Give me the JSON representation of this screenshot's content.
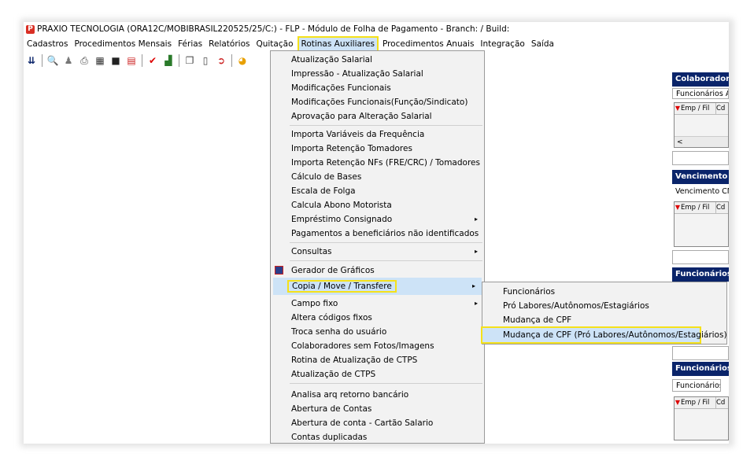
{
  "window": {
    "title": "PRAXIO TECNOLOGIA (ORA12C/MOBIBRASIL220525/25/C:) - FLP - Módulo de Folha de Pagamento - Branch:  / Build:"
  },
  "menubar": [
    {
      "label": "Cadastros"
    },
    {
      "label": "Procedimentos Mensais"
    },
    {
      "label": "Férias"
    },
    {
      "label": "Relatórios"
    },
    {
      "label": "Quitação"
    },
    {
      "label": "Rotinas Auxiliares"
    },
    {
      "label": "Procedimentos Anuais"
    },
    {
      "label": "Integração"
    },
    {
      "label": "Saída"
    }
  ],
  "toolbar_icons": [
    "down-arrows-icon",
    "search-icon",
    "users-icon",
    "printer-icon",
    "calculator-icon",
    "save-icon",
    "report-icon",
    "checkmark-icon",
    "chart-icon",
    "copy-icon",
    "document-icon",
    "export-icon",
    "pie-chart-icon"
  ],
  "menu": {
    "items": [
      {
        "label": "Atualização Salarial"
      },
      {
        "label": "Impressão - Atualização Salarial"
      },
      {
        "label": "Modificações Funcionais"
      },
      {
        "label": "Modificações Funcionais(Função/Sindicato)"
      },
      {
        "label": "Aprovação para Alteração Salarial"
      },
      {
        "label": "Importa Variáveis da Frequência"
      },
      {
        "label": "Importa Retenção Tomadores"
      },
      {
        "label": "Importa Retenção NFs (FRE/CRC) / Tomadores"
      },
      {
        "label": "Cálculo de Bases"
      },
      {
        "label": "Escala de Folga"
      },
      {
        "label": "Calcula Abono Motorista"
      },
      {
        "label": "Empréstimo Consignado"
      },
      {
        "label": "Pagamentos a beneficiários não identificados"
      },
      {
        "label": "Consultas"
      },
      {
        "label": "Gerador de Gráficos"
      },
      {
        "label": "Copia / Move / Transfere"
      },
      {
        "label": "Campo fixo"
      },
      {
        "label": "Altera códigos fixos"
      },
      {
        "label": "Troca senha do usuário"
      },
      {
        "label": "Colaboradores sem Fotos/Imagens"
      },
      {
        "label": "Rotina de Atualização de CTPS"
      },
      {
        "label": "Atualização de CTPS"
      },
      {
        "label": "Analisa arq retorno bancário"
      },
      {
        "label": "Abertura de Contas"
      },
      {
        "label": "Abertura de conta - Cartão Salario"
      },
      {
        "label": "Contas duplicadas"
      }
    ],
    "arrow": "▸"
  },
  "submenu": {
    "items": [
      {
        "label": "Funcionários"
      },
      {
        "label": "Pró Labores/Autônomos/Estagiários"
      },
      {
        "label": "Mudança de CPF"
      },
      {
        "label": "Mudança de CPF (Pró Labores/Autônomos/Estagiários)"
      }
    ]
  },
  "right_panel": {
    "sections": [
      {
        "title": "Colaboradores",
        "subtitle": "Funcionários Afa",
        "col1": "Emp / Fil",
        "col2": "Cd"
      },
      {
        "title": "Vencimento d",
        "subtitle": "Vencimento CNH",
        "col1": "Emp / Fil",
        "col2": "Cd"
      },
      {
        "title": "Funcionários c",
        "subtitle": "",
        "col1": "",
        "col2": ""
      },
      {
        "title": "Funcionários c",
        "subtitle": "Funcionários",
        "col1": "Emp / Fil",
        "col2": "Cd"
      }
    ],
    "scroll_left": "<"
  },
  "colors": {
    "section_header": "#0a246a",
    "highlight": "#cde3f7",
    "callout": "#f5e11a"
  }
}
